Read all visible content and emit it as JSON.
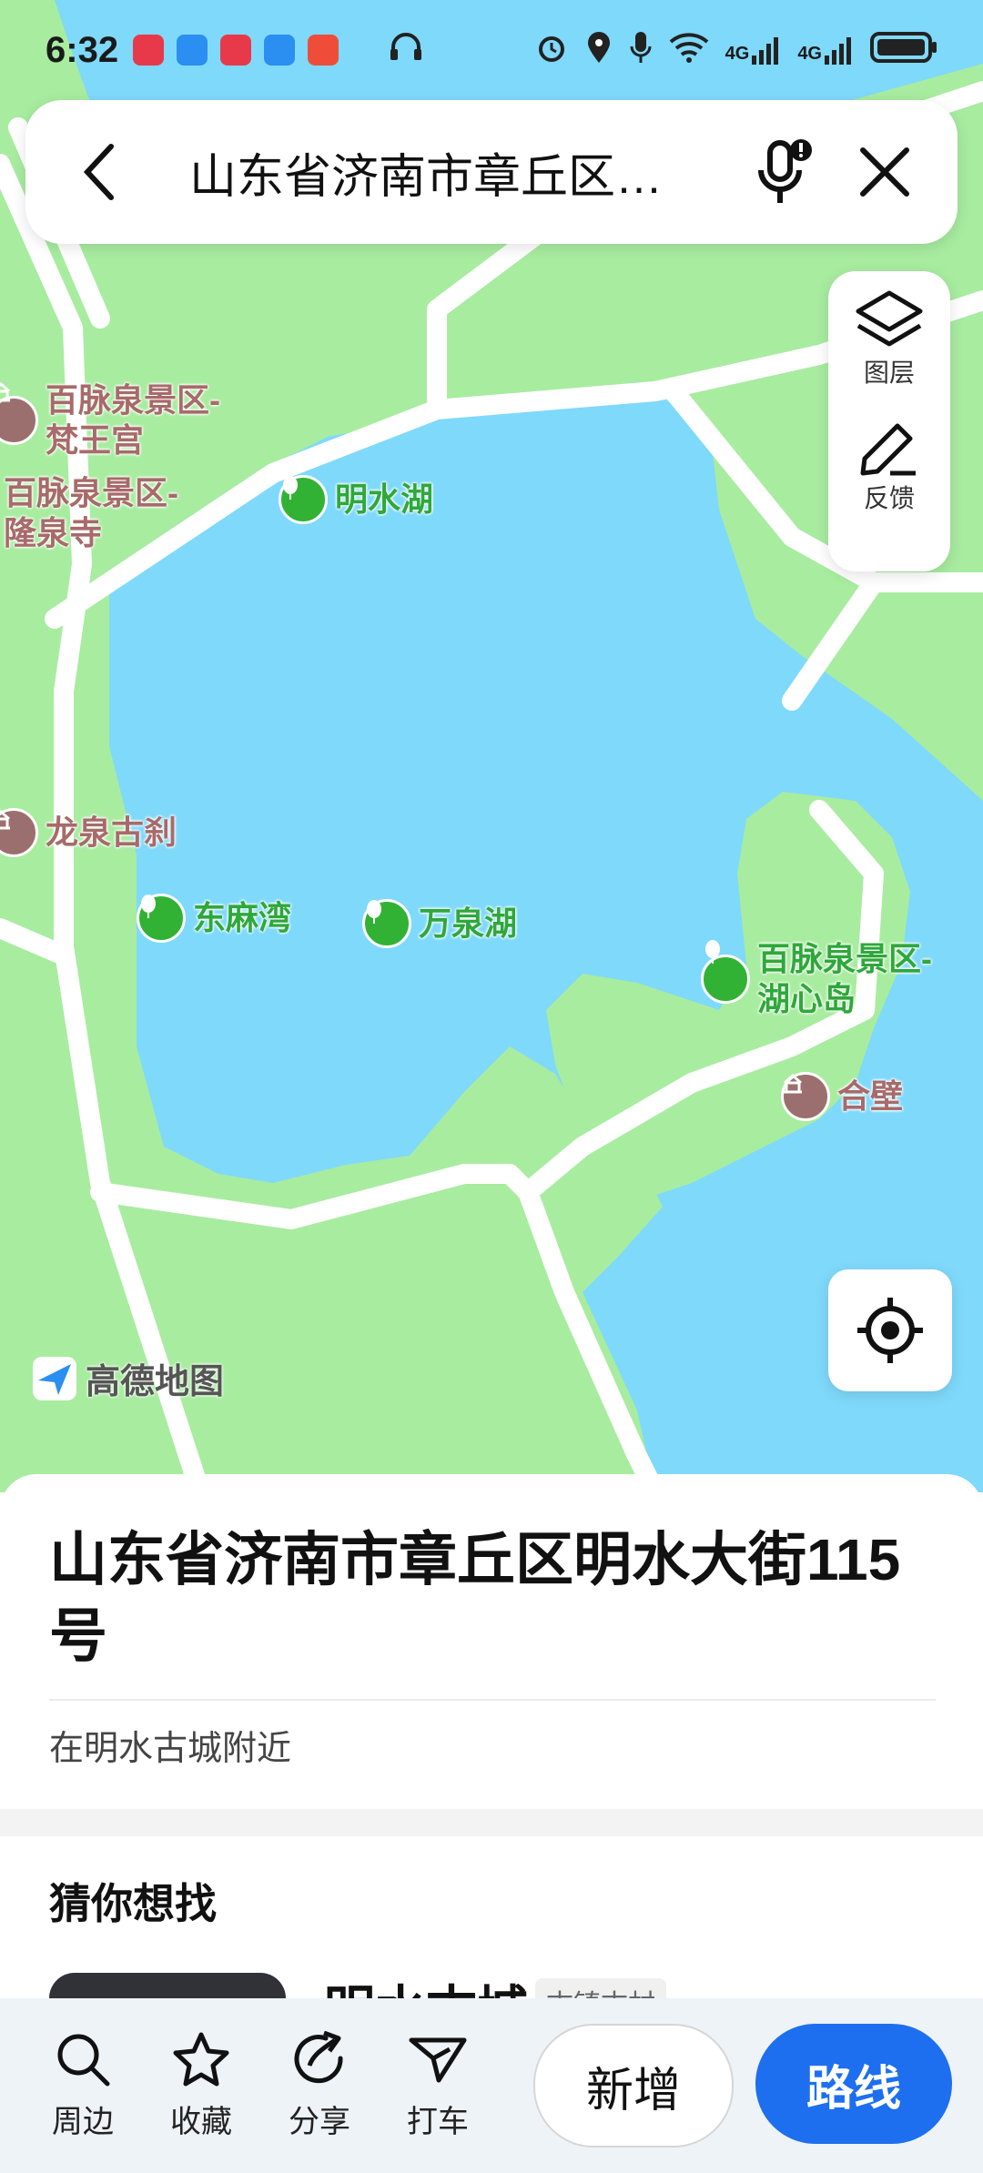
{
  "status_bar": {
    "time": "6:32",
    "app_icons": [
      "huawei-app-icon",
      "messages-icon",
      "books-icon",
      "cloud-icon",
      "recorder-icon"
    ],
    "network_label_1": "4G",
    "network_label_2": "4G"
  },
  "search": {
    "query": "山东省济南市章丘区…"
  },
  "map_tools": {
    "layers_label": "图层",
    "feedback_label": "反馈"
  },
  "map": {
    "logo_text": "高德地图",
    "pois": [
      {
        "label": "百脉泉景区-\n梵王宫",
        "kind": "brown"
      },
      {
        "label": "明水湖",
        "kind": "green"
      },
      {
        "label": "百脉泉景区-\n隆泉寺",
        "kind": "brown"
      },
      {
        "label": "龙泉古刹",
        "kind": "brown"
      },
      {
        "label": "东麻湾",
        "kind": "green"
      },
      {
        "label": "万泉湖",
        "kind": "green"
      },
      {
        "label": "百脉泉景区-\n湖心岛",
        "kind": "green"
      },
      {
        "label": "合壁",
        "kind": "brown"
      }
    ]
  },
  "sheet": {
    "address": "山东省济南市章丘区明水大街115号",
    "nearby": "在明水古城附近",
    "guess_title": "猜你想找",
    "card_title": "明水古城",
    "card_tag": "古镇古村"
  },
  "toolbar": {
    "nearby": "周边",
    "favorite": "收藏",
    "share": "分享",
    "taxi": "打车",
    "add": "新增",
    "route": "路线"
  },
  "colors": {
    "water": "#7fd9fb",
    "land": "#a8eca0",
    "road": "#ffffff",
    "route_button": "#1e6fef"
  }
}
